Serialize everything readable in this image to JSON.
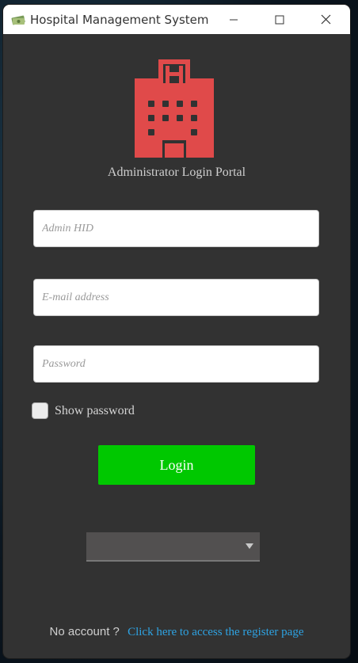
{
  "window": {
    "title": "Hospital Management System",
    "app_icon": "money-stack-icon",
    "controls": [
      "minimize-icon",
      "maximize-icon",
      "close-icon"
    ]
  },
  "header": {
    "logo_icon": "hospital-building-icon",
    "logo_color": "#e04a4a",
    "subtitle": "Administrator Login Portal"
  },
  "form": {
    "admin_hid": {
      "placeholder": "Admin HID",
      "value": ""
    },
    "email": {
      "placeholder": "E-mail address",
      "value": ""
    },
    "password": {
      "placeholder": "Password",
      "value": ""
    },
    "show_password": {
      "label": "Show password",
      "checked": false
    },
    "login_label": "Login",
    "login_color": "#00c800",
    "dropdown": {
      "value": ""
    }
  },
  "footer": {
    "question": "No account ?",
    "register_link": "Click here to access the register page",
    "link_color": "#2ea3e3"
  }
}
